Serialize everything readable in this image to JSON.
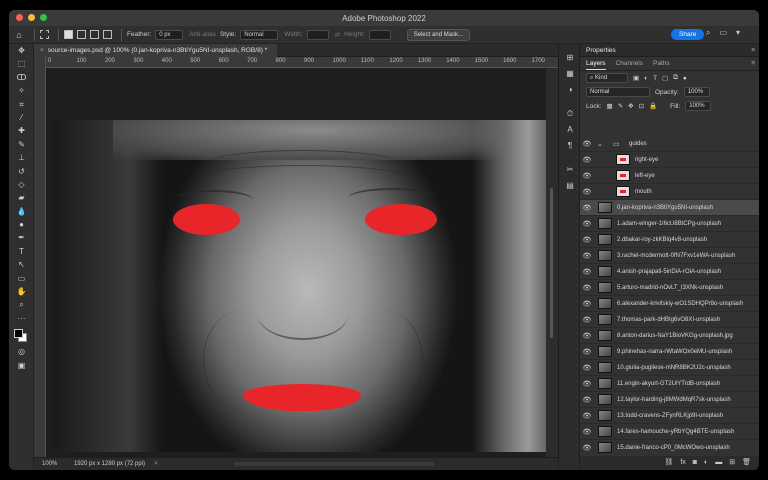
{
  "window": {
    "title": "Adobe Photoshop 2022"
  },
  "colors": {
    "close": "#ff5f57",
    "minimize": "#febc2e",
    "zoom": "#28c840",
    "share_bg": "#1473e6",
    "mask": "#e8262a"
  },
  "options_bar": {
    "feather_label": "Feather:",
    "feather_value": "0 px",
    "antialias_label": "Anti-alias",
    "style_label": "Style:",
    "style_value": "Normal",
    "width_label": "Width:",
    "height_label": "Height:",
    "select_mask_label": "Select and Mask...",
    "share_label": "Share"
  },
  "document": {
    "tab_title": "source-images.psd @ 100% (0.jan-kopriva-n3BtiYgu5NI-unsplash, RGB/8) *",
    "ruler_ticks": [
      "0",
      "100",
      "200",
      "300",
      "400",
      "500",
      "600",
      "700",
      "800",
      "900",
      "1000",
      "1100",
      "1200",
      "1300",
      "1400",
      "1500",
      "1600",
      "1700"
    ],
    "status_zoom": "100%",
    "status_dims": "1920 px x 1280 px (72 ppi)",
    "status_arrow": ">"
  },
  "panel": {
    "title": "Properties",
    "tabs": [
      "Layers",
      "Channels",
      "Paths"
    ],
    "kind_label": "Kind",
    "blend_mode": "Normal",
    "opacity_label": "Opacity:",
    "opacity_value": "100%",
    "lock_label": "Lock:",
    "fill_label": "Fill:",
    "fill_value": "100%"
  },
  "layers": [
    {
      "name": "guides",
      "type": "group",
      "selected": false
    },
    {
      "name": "right-eye",
      "type": "guide",
      "selected": false
    },
    {
      "name": "left-eye",
      "type": "guide",
      "selected": false
    },
    {
      "name": "mouth",
      "type": "guide",
      "selected": false
    },
    {
      "name": "0.jan-kopriva-n3BtiYgu5NI-unsplash",
      "type": "image",
      "selected": true
    },
    {
      "name": "1.adam-winger-1I6cU8BtCPg-unsplash",
      "type": "image",
      "selected": false
    },
    {
      "name": "2.dbakar-roy-zkKBlq4v8-unsplash",
      "type": "image",
      "selected": false
    },
    {
      "name": "3.rachel-mcdermott-0fN7Fxv1eWA-unsplash",
      "type": "image",
      "selected": false
    },
    {
      "name": "4.anish-prajapati-5inDiA-rOiA-unsplash",
      "type": "image",
      "selected": false
    },
    {
      "name": "5.arturo-madrid-nOvLT_t3XNk-unsplash",
      "type": "image",
      "selected": false
    },
    {
      "name": "6.alexander-krivitskiy-wO1SDHQPr8o-unsplash",
      "type": "image",
      "selected": false
    },
    {
      "name": "7.thomas-park-dHBIg6vO8XI-unsplash",
      "type": "image",
      "selected": false
    },
    {
      "name": "8.anton-darius-NaY1BioVKGg-unsplash.jpg",
      "type": "image",
      "selected": false
    },
    {
      "name": "9.phinehas-narra-rWtaWOx0eMU-unsplash",
      "type": "image",
      "selected": false
    },
    {
      "name": "10.giulia-pugliese-mNR8BK2U2c-unsplash",
      "type": "image",
      "selected": false
    },
    {
      "name": "11.engin-akyurt-GT2UiYTrdB-unsplash",
      "type": "image",
      "selected": false
    },
    {
      "name": "12.taylor-harding-j8MWdMqR7sk-unsplash",
      "type": "image",
      "selected": false
    },
    {
      "name": "13.todd-cravens-ZFynRLKjp9I-unsplash",
      "type": "image",
      "selected": false
    },
    {
      "name": "14.fares-hamouche-yRbYQg4BTE-unsplash",
      "type": "image",
      "selected": false
    },
    {
      "name": "15.danie-franco-cP0_0McWOwo-unsplash",
      "type": "image",
      "selected": false
    }
  ]
}
